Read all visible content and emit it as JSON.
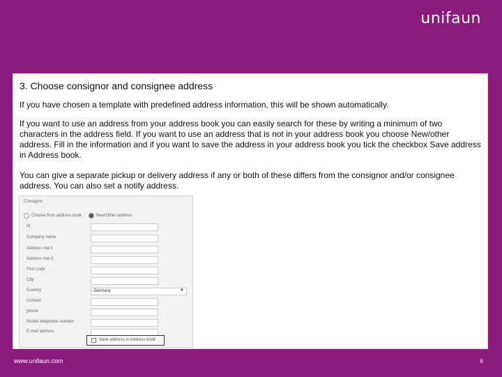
{
  "brand": {
    "logo": "unifaun",
    "accent": "#8a1a7c"
  },
  "content": {
    "heading": "3. Choose consignor and consignee address",
    "paragraphs": [
      "If you have chosen a template with predefined address information, this will be shown automatically.",
      "If you want to use an address from your address book you can easily search for these by writing a minimum of two characters in the address field. If you want to use an address that is not in your address book you choose New/other address. Fill in the information and if you want to save the address in your address book you tick the checkbox Save address in Address book.",
      "You can give a separate pickup or delivery address if any or both of these differs from the consignor and/or consignee address.  You can also set a notify address."
    ]
  },
  "form": {
    "title": "Consignor",
    "radio_options": [
      "Choose from address book",
      "New/Other address"
    ],
    "selected_radio": "New/Other address",
    "fields": [
      "Id",
      "Company name",
      "Address row 1",
      "Address row 2",
      "Post code",
      "City",
      "Country",
      "Contact",
      "phone",
      "Mobile telephone number",
      "E-mail address"
    ],
    "country_value": "Germany",
    "save_checkbox_label": "Save address in Address book"
  },
  "footer": {
    "url": "www.unifaun.com",
    "page": "6"
  }
}
